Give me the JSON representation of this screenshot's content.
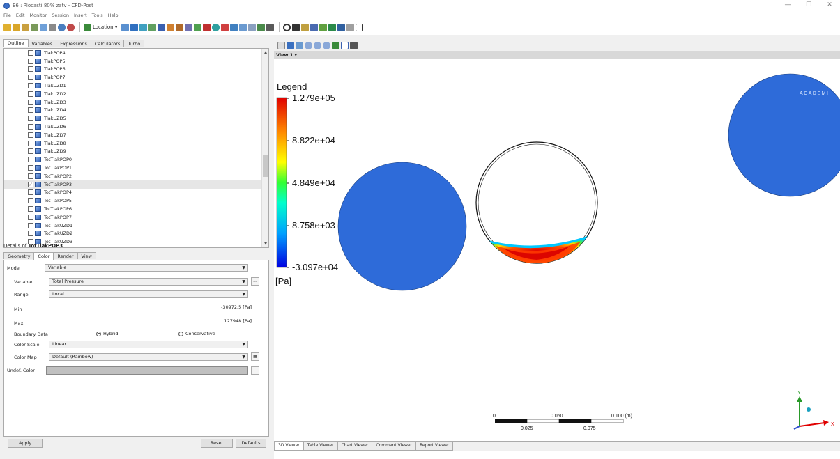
{
  "window": {
    "title": "E6 : Plocasti 80% zatv - CFD-Post",
    "minimize": "—",
    "maximize": "☐",
    "close": "✕"
  },
  "menu": [
    "File",
    "Edit",
    "Monitor",
    "Session",
    "Insert",
    "Tools",
    "Help"
  ],
  "toolbar": {
    "location_label": "Location ▾"
  },
  "outline_tabs": [
    "Outline",
    "Variables",
    "Expressions",
    "Calculators",
    "Turbo"
  ],
  "tree_items": [
    {
      "label": "TlakPOP4",
      "checked": false
    },
    {
      "label": "TlakPOP5",
      "checked": false
    },
    {
      "label": "TlakPOP6",
      "checked": false
    },
    {
      "label": "TlakPOP7",
      "checked": false
    },
    {
      "label": "TlakUZD1",
      "checked": false
    },
    {
      "label": "TlakUZD2",
      "checked": false
    },
    {
      "label": "TlakUZD3",
      "checked": false
    },
    {
      "label": "TlakUZD4",
      "checked": false
    },
    {
      "label": "TlakUZD5",
      "checked": false
    },
    {
      "label": "TlakUZD6",
      "checked": false
    },
    {
      "label": "TlakUZD7",
      "checked": false
    },
    {
      "label": "TlakUZD8",
      "checked": false
    },
    {
      "label": "TlakUZD9",
      "checked": false
    },
    {
      "label": "TotTlakPOP0",
      "checked": false
    },
    {
      "label": "TotTlakPOP1",
      "checked": false
    },
    {
      "label": "TotTlakPOP2",
      "checked": false
    },
    {
      "label": "TotTlakPOP3",
      "checked": true,
      "selected": true
    },
    {
      "label": "TotTlakPOP4",
      "checked": false
    },
    {
      "label": "TotTlakPOP5",
      "checked": false
    },
    {
      "label": "TotTlakPOP6",
      "checked": false
    },
    {
      "label": "TotTlakPOP7",
      "checked": false
    },
    {
      "label": "TotTlakUZD1",
      "checked": false
    },
    {
      "label": "TotTlakUZD2",
      "checked": false
    },
    {
      "label": "TotTlakUZD3",
      "checked": false
    }
  ],
  "details": {
    "title_prefix": "Details of ",
    "title_object": "TotTlakPOP3",
    "tabs": [
      "Geometry",
      "Color",
      "Render",
      "View"
    ],
    "mode_label": "Mode",
    "mode_value": "Variable",
    "variable_label": "Variable",
    "variable_value": "Total Pressure",
    "range_label": "Range",
    "range_value": "Local",
    "min_label": "Min",
    "min_value": "-30972.5 [Pa]",
    "max_label": "Max",
    "max_value": "127948 [Pa]",
    "boundary_label": "Boundary Data",
    "hybrid_label": "Hybrid",
    "conservative_label": "Conservative",
    "color_scale_label": "Color Scale",
    "color_scale_value": "Linear",
    "color_map_label": "Color Map",
    "color_map_value": "Default (Rainbow)",
    "undef_label": "Undef. Color",
    "dots": "..."
  },
  "buttons": {
    "apply": "Apply",
    "reset": "Reset",
    "defaults": "Defaults"
  },
  "viewer": {
    "view_label": "View 1 ▾",
    "legend_title": "Legend",
    "legend_values": [
      "1.279e+05",
      "8.822e+04",
      "4.849e+04",
      "8.758e+03",
      "-3.097e+04"
    ],
    "legend_unit": "[Pa]",
    "watermark": "ACADEMI",
    "scale_labels_top": [
      "0",
      "0.050",
      "0.100 (m)"
    ],
    "scale_labels_bottom": [
      "0.025",
      "0.075"
    ],
    "axis_y": "Y",
    "axis_x": "X",
    "tabs": [
      "3D Viewer",
      "Table Viewer",
      "Chart Viewer",
      "Comment Viewer",
      "Report Viewer"
    ],
    "colors": {
      "pipe_fill": "#2e6bd9",
      "accent_red": "#e00000"
    }
  }
}
